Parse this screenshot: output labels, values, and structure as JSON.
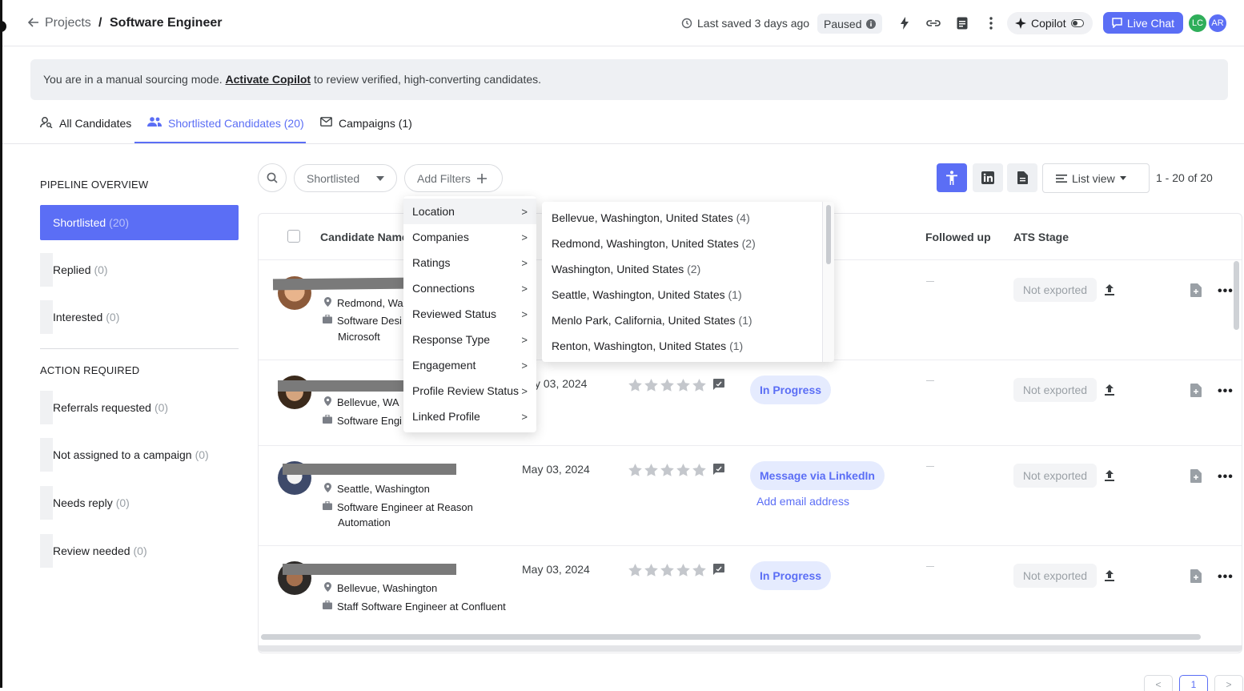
{
  "header": {
    "breadcrumb_parent": "Projects",
    "breadcrumb_sep": "/",
    "breadcrumb_current": "Software Engineer",
    "last_saved": "Last saved 3 days ago",
    "status": "Paused",
    "copilot_label": "Copilot",
    "live_chat_label": "Live Chat",
    "avatars": [
      {
        "initials": "LC",
        "color": "#2fae5a"
      },
      {
        "initials": "AR",
        "color": "#5b6ef5"
      }
    ]
  },
  "banner": {
    "prefix": "You are in a manual sourcing mode.",
    "link": "Activate Copilot",
    "suffix": "to review verified, high-converting candidates."
  },
  "tabs": [
    {
      "label": "All Candidates"
    },
    {
      "label": "Shortlisted Candidates (20)"
    },
    {
      "label": "Campaigns (1)"
    }
  ],
  "sidebar": {
    "pipeline_heading": "PIPELINE OVERVIEW",
    "pipeline": [
      {
        "label": "Shortlisted",
        "count": "(20)"
      },
      {
        "label": "Replied",
        "count": "(0)"
      },
      {
        "label": "Interested",
        "count": "(0)"
      }
    ],
    "action_heading": "ACTION REQUIRED",
    "actions": [
      {
        "label": "Referrals requested",
        "count": "(0)"
      },
      {
        "label": "Not assigned to a campaign",
        "count": "(0)"
      },
      {
        "label": "Needs reply",
        "count": "(0)"
      },
      {
        "label": "Review needed",
        "count": "(0)"
      }
    ]
  },
  "toolbar": {
    "stage_filter": "Shortlisted",
    "add_filters": "Add Filters",
    "view_label": "List view",
    "range": "1 - 20 of 20"
  },
  "table": {
    "columns": {
      "candidate": "Candidate Name",
      "followed_up": "Followed up",
      "ats_stage": "ATS Stage"
    },
    "rows": [
      {
        "location": "Redmond, Was",
        "title_line1": "Software Desi",
        "title_line2": "Microsoft",
        "date": "",
        "status": "",
        "email_link": "",
        "ats": "Not exported"
      },
      {
        "location": "Bellevue, WA",
        "title_line1": "Software Engi",
        "title_line2": "",
        "date": "y 03, 2024",
        "status": "In Progress",
        "email_link": "",
        "ats": "Not exported"
      },
      {
        "location": "Seattle, Washington",
        "title_line1": "Software Engineer at Reason",
        "title_line2": "Automation",
        "date": "May 03, 2024",
        "status": "Message via LinkedIn",
        "email_link": "Add email address",
        "ats": "Not exported"
      },
      {
        "location": "Bellevue, Washington",
        "title_line1": "Staff Software Engineer at Confluent",
        "title_line2": "",
        "date": "May 03, 2024",
        "status": "In Progress",
        "email_link": "",
        "ats": "Not exported"
      }
    ]
  },
  "filter_menu": {
    "items": [
      {
        "label": "Location"
      },
      {
        "label": "Companies"
      },
      {
        "label": "Ratings"
      },
      {
        "label": "Connections"
      },
      {
        "label": "Reviewed Status"
      },
      {
        "label": "Response Type"
      },
      {
        "label": "Engagement"
      },
      {
        "label": "Profile Review Status"
      },
      {
        "label": "Linked Profile"
      }
    ],
    "location_options": [
      {
        "label": "Bellevue, Washington, United States",
        "count": "(4)"
      },
      {
        "label": "Redmond, Washington, United States",
        "count": "(2)"
      },
      {
        "label": "Washington, United States",
        "count": "(2)"
      },
      {
        "label": "Seattle, Washington, United States",
        "count": "(1)"
      },
      {
        "label": "Menlo Park, California, United States",
        "count": "(1)"
      },
      {
        "label": "Renton, Washington, United States",
        "count": "(1)"
      }
    ]
  },
  "pagination": {
    "current": "1"
  },
  "colors": {
    "accent": "#5b6ef5",
    "status_bg": "#e5ebfe"
  }
}
